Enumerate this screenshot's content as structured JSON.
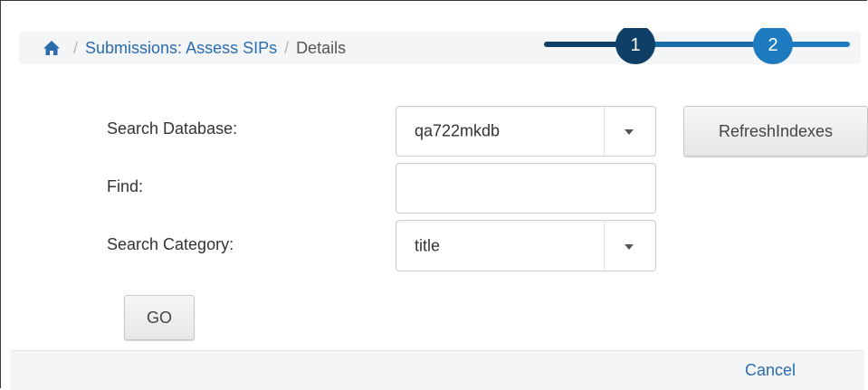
{
  "breadcrumb": {
    "home_icon": "home-icon",
    "separator": "/",
    "items": [
      {
        "label": "Submissions: Assess SIPs"
      },
      {
        "label": "Details"
      }
    ]
  },
  "stepper": {
    "steps": [
      {
        "number": "1",
        "state": "completed",
        "color": "#0f3e66"
      },
      {
        "number": "2",
        "state": "current",
        "color": "#1f7bbf"
      }
    ]
  },
  "form": {
    "search_database": {
      "label": "Search Database:",
      "value": "qa722mkdb"
    },
    "find": {
      "label": "Find:",
      "value": ""
    },
    "search_category": {
      "label": "Search Category:",
      "value": "title"
    },
    "refresh_button_label": "RefreshIndexes",
    "go_button_label": "GO"
  },
  "footer": {
    "cancel_label": "Cancel"
  },
  "colors": {
    "link": "#2a6cad",
    "step_dark": "#0f3e66",
    "step_active": "#1f7bbf"
  }
}
